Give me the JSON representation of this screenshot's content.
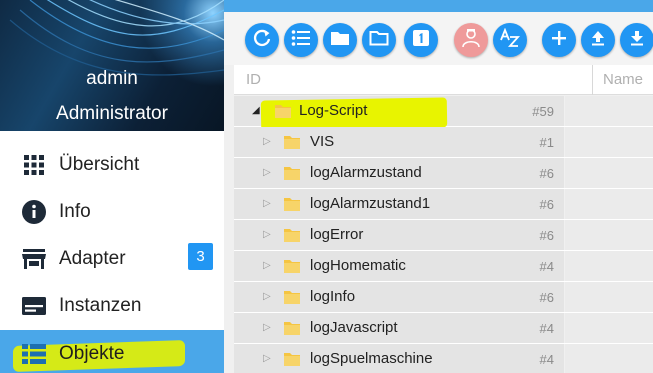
{
  "user": {
    "name": "admin",
    "role": "Administrator"
  },
  "nav": {
    "items": [
      {
        "label": "Übersicht",
        "icon": "grid-icon"
      },
      {
        "label": "Info",
        "icon": "info-icon"
      },
      {
        "label": "Adapter",
        "icon": "store-icon",
        "badge": "3"
      },
      {
        "label": "Instanzen",
        "icon": "instances-icon"
      },
      {
        "label": "Objekte",
        "icon": "list-icon",
        "active": true
      }
    ]
  },
  "toolbar": {
    "buttons": [
      {
        "icon": "refresh-icon"
      },
      {
        "icon": "list-view-icon"
      },
      {
        "icon": "folder-filled-icon"
      },
      {
        "icon": "folder-outline-icon"
      },
      {
        "icon": "number-one-icon"
      },
      {
        "icon": "expert-mode-icon"
      },
      {
        "icon": "sort-az-icon"
      },
      {
        "icon": "add-icon"
      },
      {
        "icon": "upload-icon"
      },
      {
        "icon": "download-icon"
      }
    ]
  },
  "grid": {
    "col_id": "ID",
    "col_name": "Name"
  },
  "tree": [
    {
      "label": "Log-Script",
      "count": "#59",
      "level": 0,
      "expanded": true
    },
    {
      "label": "VIS",
      "count": "#1",
      "level": 1
    },
    {
      "label": "logAlarmzustand",
      "count": "#6",
      "level": 1
    },
    {
      "label": "logAlarmzustand1",
      "count": "#6",
      "level": 1
    },
    {
      "label": "logError",
      "count": "#6",
      "level": 1
    },
    {
      "label": "logHomematic",
      "count": "#4",
      "level": 1
    },
    {
      "label": "logInfo",
      "count": "#6",
      "level": 1
    },
    {
      "label": "logJavascript",
      "count": "#4",
      "level": 1
    },
    {
      "label": "logSpuelmaschine",
      "count": "#4",
      "level": 1
    }
  ],
  "colors": {
    "accent": "#2196f3",
    "active_nav": "#4aa7e9",
    "highlight": "#e8f400",
    "folder": "#f5c542"
  }
}
